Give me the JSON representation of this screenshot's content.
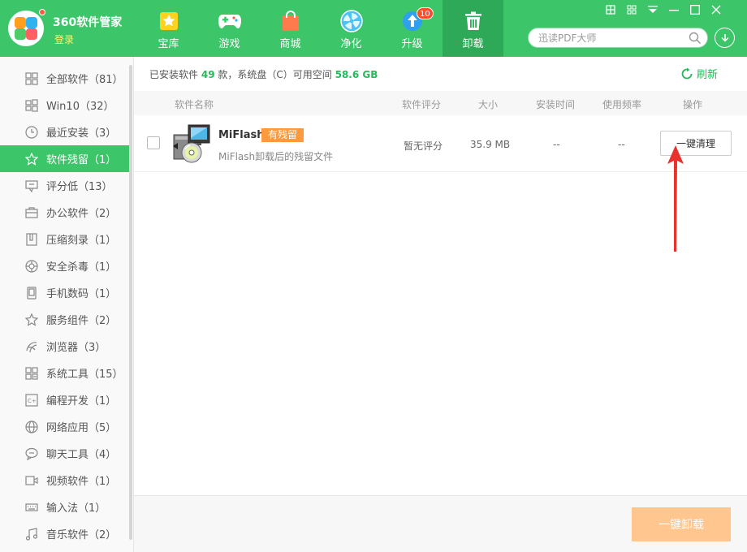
{
  "app": {
    "title": "360软件管家",
    "login": "登录"
  },
  "nav": [
    {
      "label": "宝库",
      "icon": "star-icon"
    },
    {
      "label": "游戏",
      "icon": "gamepad-icon"
    },
    {
      "label": "商城",
      "icon": "shopping-bag-icon"
    },
    {
      "label": "净化",
      "icon": "fan-icon"
    },
    {
      "label": "升级",
      "icon": "upgrade-arrow-icon",
      "badge": "10"
    },
    {
      "label": "卸载",
      "icon": "trash-icon",
      "active": true
    }
  ],
  "search": {
    "placeholder": "迅读PDF大师"
  },
  "sidebar": {
    "items": [
      {
        "label": "全部软件（81）",
        "icon": "grid-icon"
      },
      {
        "label": "Win10（32）",
        "icon": "windows-icon"
      },
      {
        "label": "最近安装（3）",
        "icon": "clock-icon"
      },
      {
        "label": "软件残留（1）",
        "icon": "star-icon",
        "active": true
      },
      {
        "label": "评分低（13）",
        "icon": "thumb-down-icon"
      },
      {
        "label": "办公软件（2）",
        "icon": "briefcase-icon"
      },
      {
        "label": "压缩刻录（1）",
        "icon": "archive-icon"
      },
      {
        "label": "安全杀毒（1）",
        "icon": "shield-icon"
      },
      {
        "label": "手机数码（1）",
        "icon": "phone-icon"
      },
      {
        "label": "服务组件（2）",
        "icon": "star-outline-icon"
      },
      {
        "label": "浏览器（3）",
        "icon": "browser-icon"
      },
      {
        "label": "系统工具（15）",
        "icon": "tools-icon"
      },
      {
        "label": "编程开发（1）",
        "icon": "code-icon"
      },
      {
        "label": "网络应用（5）",
        "icon": "globe-icon"
      },
      {
        "label": "聊天工具（4）",
        "icon": "chat-icon"
      },
      {
        "label": "视频软件（1）",
        "icon": "video-icon"
      },
      {
        "label": "输入法（1）",
        "icon": "keyboard-icon"
      },
      {
        "label": "音乐软件（2）",
        "icon": "music-icon"
      }
    ]
  },
  "summary": {
    "prefix": "已安装软件",
    "count": "49",
    "middle": "款，系统盘（C）可用空间",
    "space": "58.6 GB"
  },
  "refresh_label": "刷新",
  "table": {
    "headers": {
      "name": "软件名称",
      "rating": "软件评分",
      "size": "大小",
      "install_time": "安装时间",
      "frequency": "使用频率",
      "action": "操作"
    },
    "rows": [
      {
        "name": "MiFlash",
        "tag": "有残留",
        "desc": "MiFlash卸载后的残留文件",
        "rating": "暂无评分",
        "size": "35.9 MB",
        "install_time": "--",
        "frequency": "--",
        "action": "一键清理"
      }
    ]
  },
  "footer": {
    "uninstall_label": "一键卸载"
  },
  "colors": {
    "brand": "#3cc569",
    "active_nav": "#2ea957",
    "tag": "#ff9a3c",
    "arrow": "#e8322e",
    "disabled_button": "#ffc68f"
  }
}
